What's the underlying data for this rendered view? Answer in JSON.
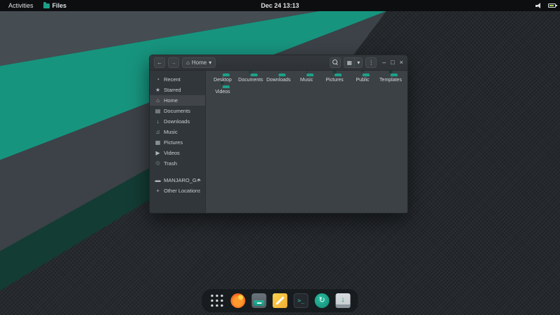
{
  "topbar": {
    "activities": "Activities",
    "app_menu": "Files",
    "clock": "Dec 24 13:13"
  },
  "window": {
    "nav": {
      "back_glyph": "←",
      "forward_glyph": "→",
      "house_glyph": "⌂",
      "location": "Home",
      "caret_glyph": "▾",
      "view_glyph": "▦",
      "view_caret_glyph": "▾",
      "menu_glyph": "⋮",
      "minimize_glyph": "–",
      "maximize_glyph": "□",
      "close_glyph": "×"
    },
    "sidebar": {
      "items": [
        {
          "label": "Recent",
          "glyph": "◔"
        },
        {
          "label": "Starred",
          "glyph": "★"
        },
        {
          "label": "Home",
          "glyph": "⌂"
        },
        {
          "label": "Documents",
          "glyph": "▤"
        },
        {
          "label": "Downloads",
          "glyph": "↓"
        },
        {
          "label": "Music",
          "glyph": "♫"
        },
        {
          "label": "Pictures",
          "glyph": "▦"
        },
        {
          "label": "Videos",
          "glyph": "▶"
        },
        {
          "label": "Trash",
          "glyph": "♲"
        }
      ],
      "device": {
        "label": "MANJARO_G...",
        "glyph": "▬"
      },
      "other": {
        "label": "Other Locations",
        "glyph": "+"
      }
    },
    "folders": [
      {
        "name": "Desktop",
        "emblem": ""
      },
      {
        "name": "Documents",
        "emblem": "▤"
      },
      {
        "name": "Downloads",
        "emblem": "↓"
      },
      {
        "name": "Music",
        "emblem": "♫"
      },
      {
        "name": "Pictures",
        "emblem": "▦"
      },
      {
        "name": "Public",
        "emblem": "⇄"
      },
      {
        "name": "Templates",
        "emblem": "▣"
      },
      {
        "name": "Videos",
        "emblem": "▶"
      }
    ]
  },
  "dock": {
    "terminal_glyph": ">_",
    "software_glyph": "↻",
    "installer_glyph": "↓"
  },
  "colors": {
    "accent": "#16a085",
    "folder": "#1ba188",
    "wallpaper_teal": "#17947e"
  }
}
